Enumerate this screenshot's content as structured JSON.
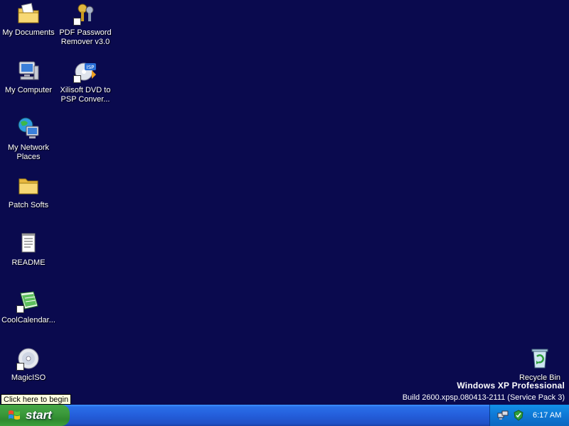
{
  "desktop_icons": {
    "my_documents": "My Documents",
    "pdf_password_remover": "PDF Password\nRemover v3.0",
    "my_computer": "My Computer",
    "xilisoft_dvd": "Xilisoft DVD to\nPSP Conver...",
    "my_network_places": "My Network\nPlaces",
    "patch_softs": "Patch Softs",
    "readme": "README",
    "coolcalendar": "CoolCalendar...",
    "magiciso": "MagicISO",
    "recycle_bin": "Recycle Bin"
  },
  "watermark": {
    "title": "Windows XP Professional",
    "build": "Build 2600.xpsp.080413-2111 (Service Pack 3)"
  },
  "tooltip": "Click here to begin",
  "taskbar": {
    "start_label": "start",
    "clock": "6:17 AM"
  },
  "colors": {
    "desktop_bg": "#0a0a4e",
    "taskbar_blue": "#245edb",
    "start_green": "#3c9a3c",
    "tray_blue": "#0e78d6"
  }
}
